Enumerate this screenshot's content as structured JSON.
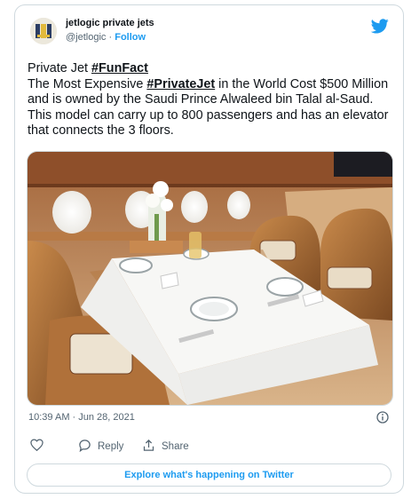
{
  "author": {
    "name": "jetlogic private jets",
    "handle": "@jetlogic",
    "separator": "·",
    "follow_label": "Follow"
  },
  "tweet": {
    "line1_prefix": "Private Jet ",
    "hashtag1": "#FunFact",
    "line2_prefix": "The Most Expensive ",
    "hashtag2": "#PrivateJet",
    "body_rest": " in the World Cost $500 Million and is owned by the Saudi Prince Alwaleed bin Talal al-Saud. This model can carry up to 800 passengers and has an elevator that connects the 3 floors."
  },
  "timestamp": "10:39 AM · Jun 28, 2021",
  "actions": {
    "reply_label": "Reply",
    "share_label": "Share"
  },
  "explore_label": "Explore what's happening on Twitter",
  "colors": {
    "accent": "#1d9bf0",
    "text": "#0f1419",
    "muted": "#536471",
    "border": "#cfd9de"
  },
  "icons": [
    "twitter-bird-icon",
    "info-icon",
    "heart-icon",
    "reply-icon",
    "share-icon"
  ]
}
